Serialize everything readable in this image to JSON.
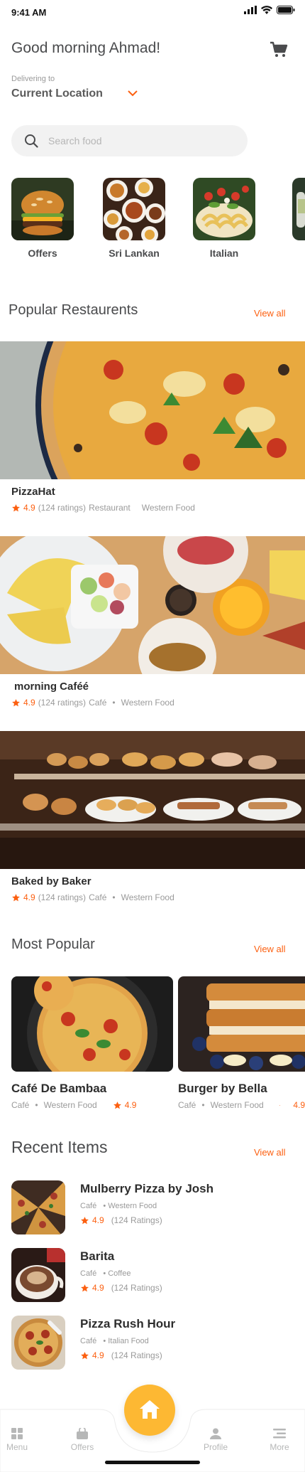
{
  "status_bar": {
    "time": "9:41 AM"
  },
  "header": {
    "greeting": "Good morning Ahmad!",
    "delivering_label": "Delivering to",
    "location": "Current Location"
  },
  "search": {
    "placeholder": "Search food"
  },
  "categories": [
    {
      "label": "Offers"
    },
    {
      "label": "Sri Lankan"
    },
    {
      "label": "Italian"
    }
  ],
  "popular_restaurants": {
    "title": "Popular Restaurents",
    "view_all": "View all",
    "items": [
      {
        "name": "PizzaHat",
        "rating": "4.9",
        "ratings_count": "(124 ratings)",
        "type": "Restaurant",
        "separator": "",
        "cuisine": "Western Food"
      },
      {
        "name": "morning Caféé",
        "rating": "4.9",
        "ratings_count": "(124 ratings)",
        "type": "Café",
        "separator": "•",
        "cuisine": "Western Food"
      },
      {
        "name": "Baked by Baker",
        "rating": "4.9",
        "ratings_count": "(124 ratings)",
        "type": "Café",
        "separator": "•",
        "cuisine": "Western Food"
      }
    ]
  },
  "most_popular": {
    "title": "Most Popular",
    "view_all": "View all",
    "items": [
      {
        "name": "Café De Bambaa",
        "type": "Café",
        "separator": "•",
        "cuisine": "Western Food",
        "rating": "4.9"
      },
      {
        "name": "Burger by Bella",
        "type": "Café",
        "separator": "•",
        "cuisine": "Western Food",
        "rating": "4.9"
      }
    ]
  },
  "recent_items": {
    "title": "Recent Items",
    "view_all": "View all",
    "items": [
      {
        "name": "Mulberry Pizza by Josh",
        "type": "Café",
        "cuisine": "• Western Food",
        "rating": "4.9",
        "ratings_count": "(124 Ratings)"
      },
      {
        "name": "Barita",
        "type": "Café",
        "cuisine": "• Coffee",
        "rating": "4.9",
        "ratings_count": "(124 Ratings)"
      },
      {
        "name": "Pizza Rush Hour",
        "type": "Café",
        "cuisine": "• Italian Food",
        "rating": "4.9",
        "ratings_count": "(124 Ratings)"
      }
    ]
  },
  "tab_bar": {
    "menu": "Menu",
    "offers": "Offers",
    "profile": "Profile",
    "more": "More"
  },
  "colors": {
    "accent": "#fc6011",
    "home_button": "#fdb833",
    "text_primary": "#4a4b4d",
    "text_secondary": "#9a9a9a"
  }
}
